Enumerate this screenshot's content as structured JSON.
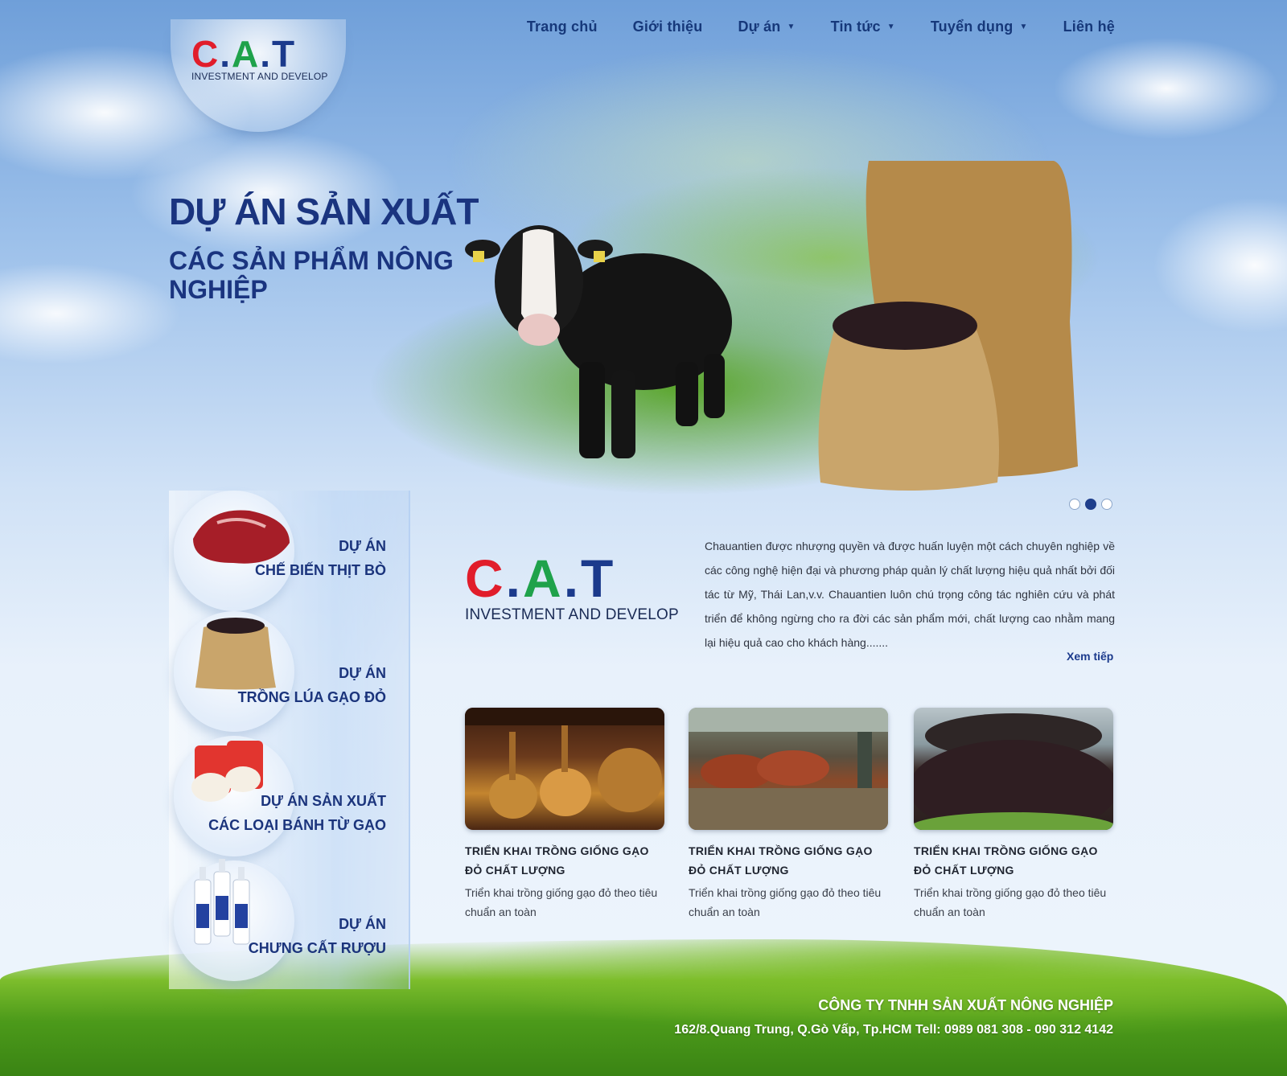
{
  "nav": {
    "items": [
      {
        "label": "Trang chủ",
        "has_dropdown": false
      },
      {
        "label": "Giới thiệu",
        "has_dropdown": false
      },
      {
        "label": "Dự án",
        "has_dropdown": true
      },
      {
        "label": "Tin tức",
        "has_dropdown": true
      },
      {
        "label": "Tuyển dụng",
        "has_dropdown": true
      },
      {
        "label": "Liên hệ",
        "has_dropdown": false
      }
    ]
  },
  "logo": {
    "c": "C",
    "dot1": ".",
    "a": "A",
    "dot2": ".",
    "t": "T",
    "subtitle": "INVESTMENT AND DEVELOP",
    "colors": {
      "c": "#e11d2b",
      "a": "#1fa24b",
      "t": "#1b3a8c"
    }
  },
  "hero": {
    "title": "DỰ ÁN SẢN XUẤT",
    "subtitle": "CÁC SẢN PHẨM NÔNG NGHIỆP",
    "slides_count": 3,
    "active_slide": 2
  },
  "sidebar": {
    "items": [
      {
        "line1": "DỰ ÁN",
        "line2": "CHẾ BIẾN THỊT BÒ",
        "icon": "beef-icon"
      },
      {
        "line1": "DỰ ÁN",
        "line2": "TRỒNG LÚA GẠO ĐỎ",
        "icon": "rice-sack-icon"
      },
      {
        "line1": "DỰ ÁN SẢN XUẤT",
        "line2": "CÁC LOẠI BÁNH TỪ GẠO",
        "icon": "rice-cake-icon"
      },
      {
        "line1": "DỰ ÁN",
        "line2": "CHƯNG CẤT RƯỢU",
        "icon": "liquor-bottles-icon"
      }
    ]
  },
  "intro": {
    "text": "Chauantien được nhượng quyền và được huấn luyện một cách chuyên nghiệp về các công nghệ hiện đại và phương pháp quản lý chất lượng hiệu quả nhất bởi đối tác từ Mỹ, Thái Lan,v.v. Chauantien luôn chú trọng công tác nghiên cứu và phát triển để không ngừng cho ra đời các sản phẩm mới, chất lượng cao nhằm mang lại hiệu quả cao cho khách hàng.......",
    "more": "Xem tiếp"
  },
  "cards": [
    {
      "title": "TRIỂN KHAI TRỒNG GIỐNG GẠO ĐỎ CHẤT LƯỢNG",
      "desc": "Triển khai trồng giống gạo đỏ theo tiêu chuẩn an toàn",
      "image": "distillery-image"
    },
    {
      "title": "TRIỂN KHAI TRỒNG GIỐNG GẠO ĐỎ CHẤT LƯỢNG",
      "desc": "Triển khai trồng giống gạo đỏ theo tiêu chuẩn an toàn",
      "image": "cattle-barn-image"
    },
    {
      "title": "TRIỂN KHAI TRỒNG GIỐNG GẠO ĐỎ CHẤT LƯỢNG",
      "desc": "Triển khai trồng giống gạo đỏ theo tiêu chuẩn an toàn",
      "image": "red-rice-bowl-image"
    }
  ],
  "footer": {
    "company": "CÔNG TY  TNHH SẢN XUẤT NÔNG NGHIỆP",
    "address": "162/8.Quang  Trung, Q.Gò Vấp, Tp.HCM  Tell: 0989 081 308 - 090 312 4142"
  }
}
